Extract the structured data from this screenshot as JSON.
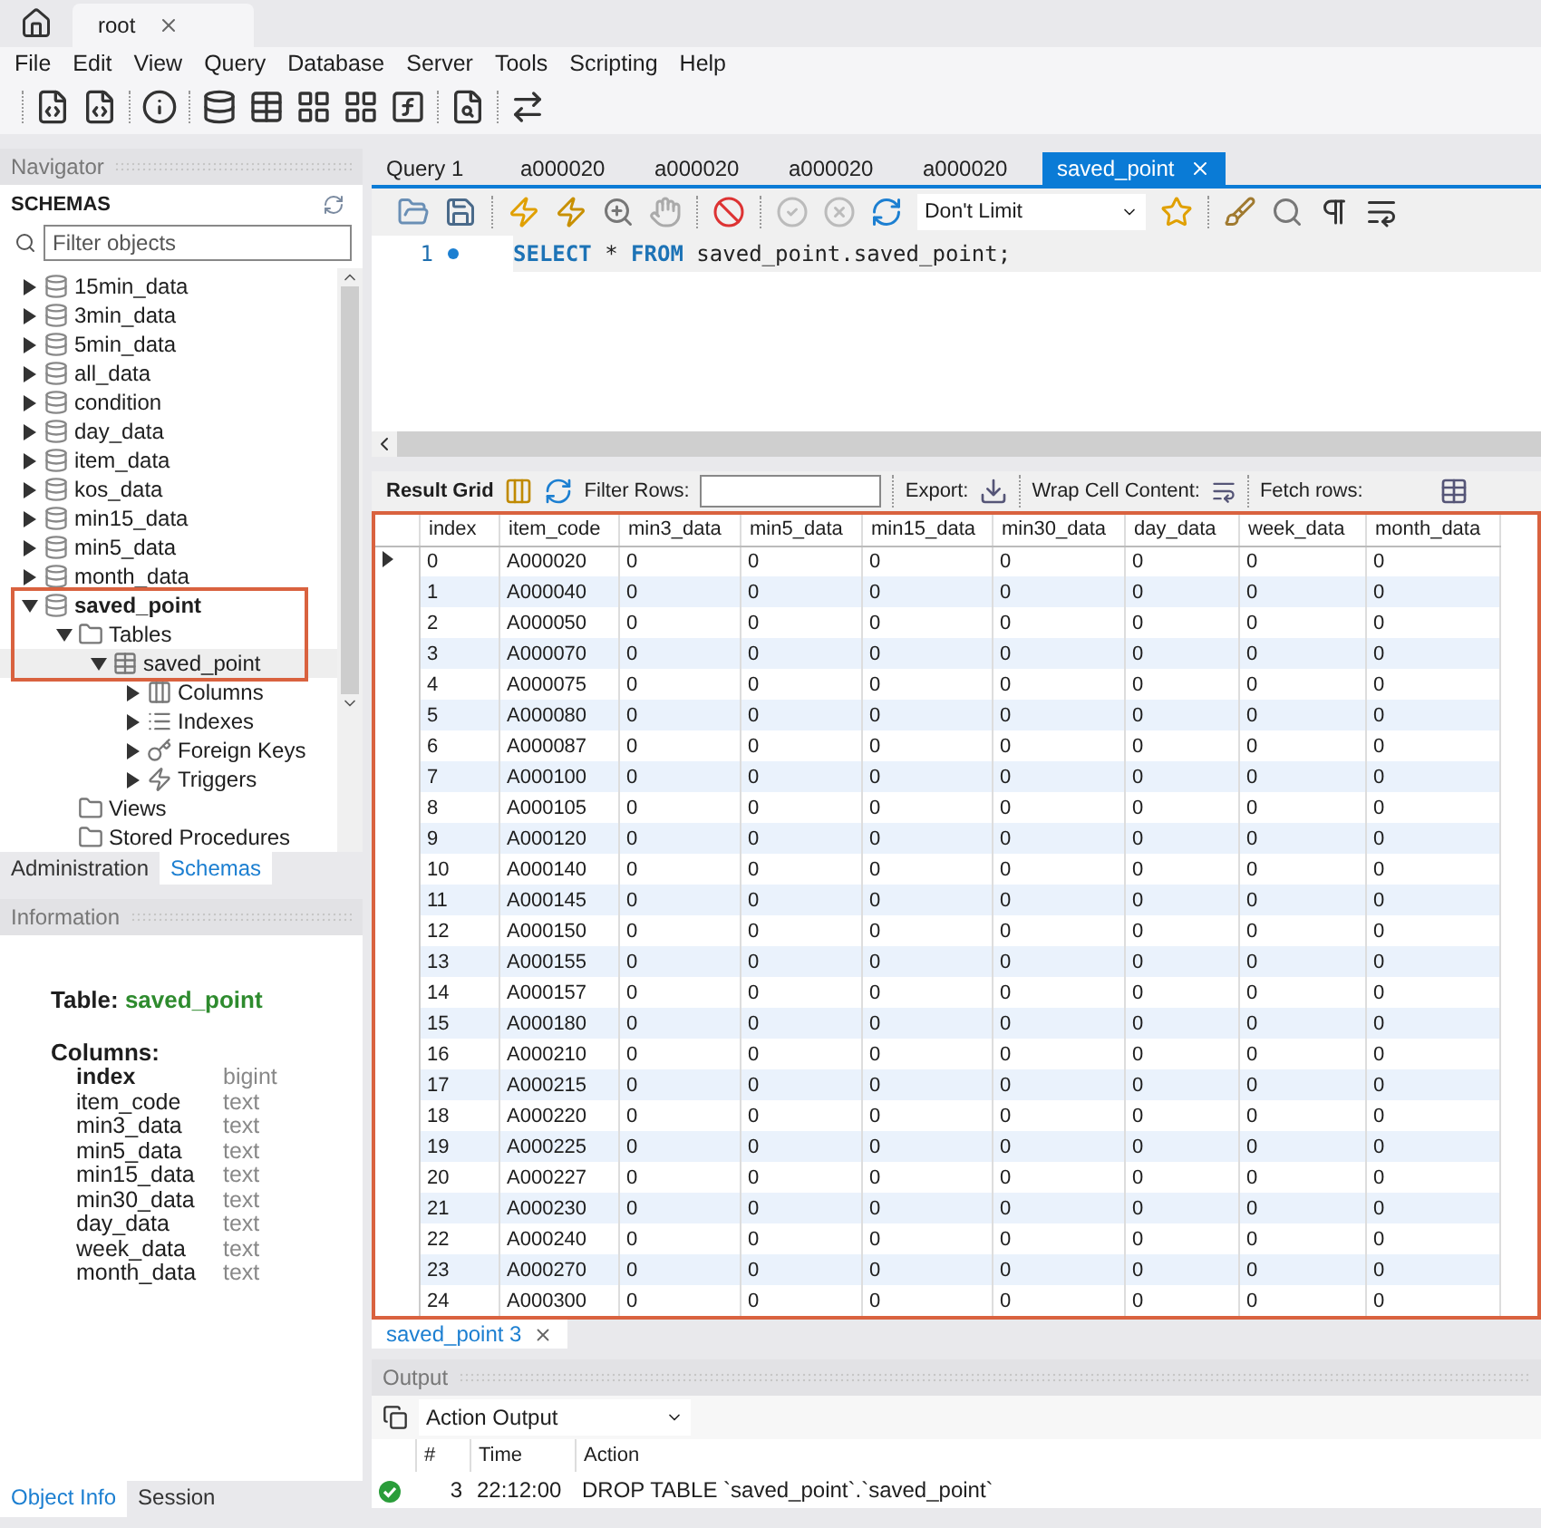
{
  "app_tabs": [
    {
      "label": "root",
      "selected": true
    }
  ],
  "menu": [
    "File",
    "Edit",
    "View",
    "Query",
    "Database",
    "Server",
    "Tools",
    "Scripting",
    "Help"
  ],
  "navigator": {
    "title": "Navigator",
    "schemas_title": "SCHEMAS",
    "filter_placeholder": "Filter objects",
    "tree": [
      {
        "label": "15min_data",
        "kind": "schema",
        "expanded": false
      },
      {
        "label": "3min_data",
        "kind": "schema",
        "expanded": false
      },
      {
        "label": "5min_data",
        "kind": "schema",
        "expanded": false
      },
      {
        "label": "all_data",
        "kind": "schema",
        "expanded": false
      },
      {
        "label": "condition",
        "kind": "schema",
        "expanded": false
      },
      {
        "label": "day_data",
        "kind": "schema",
        "expanded": false
      },
      {
        "label": "item_data",
        "kind": "schema",
        "expanded": false
      },
      {
        "label": "kos_data",
        "kind": "schema",
        "expanded": false
      },
      {
        "label": "min15_data",
        "kind": "schema",
        "expanded": false
      },
      {
        "label": "min5_data",
        "kind": "schema",
        "expanded": false
      },
      {
        "label": "month_data",
        "kind": "schema",
        "expanded": false
      },
      {
        "label": "saved_point",
        "kind": "schema",
        "expanded": true,
        "default": true,
        "outlined": true,
        "children": [
          {
            "label": "Tables",
            "kind": "folder",
            "expanded": true,
            "outlined": true,
            "children": [
              {
                "label": "saved_point",
                "kind": "table",
                "expanded": true,
                "selected": true,
                "outlined": true,
                "children": [
                  {
                    "label": "Columns",
                    "kind": "columns",
                    "expanded": false
                  },
                  {
                    "label": "Indexes",
                    "kind": "indexes",
                    "expanded": false
                  },
                  {
                    "label": "Foreign Keys",
                    "kind": "foreign_keys",
                    "expanded": false
                  },
                  {
                    "label": "Triggers",
                    "kind": "triggers",
                    "expanded": false
                  }
                ]
              }
            ]
          },
          {
            "label": "Views",
            "kind": "folder"
          },
          {
            "label": "Stored Procedures",
            "kind": "folder"
          }
        ]
      }
    ],
    "tabs": [
      {
        "label": "Administration",
        "selected": false
      },
      {
        "label": "Schemas",
        "selected": true
      }
    ]
  },
  "information": {
    "title": "Information",
    "table_label": "Table:",
    "table_name": "saved_point",
    "columns_label": "Columns:",
    "columns": [
      {
        "name": "index",
        "type": "bigint",
        "key": true
      },
      {
        "name": "item_code",
        "type": "text"
      },
      {
        "name": "min3_data",
        "type": "text"
      },
      {
        "name": "min5_data",
        "type": "text"
      },
      {
        "name": "min15_data",
        "type": "text"
      },
      {
        "name": "min30_data",
        "type": "text"
      },
      {
        "name": "day_data",
        "type": "text"
      },
      {
        "name": "week_data",
        "type": "text"
      },
      {
        "name": "month_data",
        "type": "text"
      }
    ],
    "tabs": [
      {
        "label": "Object Info",
        "selected": true
      },
      {
        "label": "Session",
        "selected": false
      }
    ]
  },
  "query_tabs": [
    {
      "label": "Query 1",
      "selected": false
    },
    {
      "label": "a000020",
      "selected": false
    },
    {
      "label": "a000020",
      "selected": false
    },
    {
      "label": "a000020",
      "selected": false
    },
    {
      "label": "a000020",
      "selected": false
    },
    {
      "label": "saved_point",
      "selected": true
    }
  ],
  "limit": "Don't Limit",
  "editor": {
    "lines": [
      {
        "number": "1",
        "tokens": [
          {
            "kind": "keyword",
            "text": "SELECT"
          },
          {
            "kind": "plain",
            "text": " * "
          },
          {
            "kind": "keyword",
            "text": "FROM"
          },
          {
            "kind": "plain",
            "text": " saved_point.saved_point;"
          }
        ]
      }
    ]
  },
  "result_toolbar": {
    "grid_label": "Result Grid",
    "filter_label": "Filter Rows:",
    "export_label": "Export:",
    "wrap_label": "Wrap Cell Content:",
    "fetch_label": "Fetch rows:"
  },
  "grid": {
    "outlined": true,
    "columns": [
      "index",
      "item_code",
      "min3_data",
      "min5_data",
      "min15_data",
      "min30_data",
      "day_data",
      "week_data",
      "month_data"
    ],
    "rows": [
      {
        "current": true,
        "cells": [
          "0",
          "A000020",
          "0",
          "0",
          "0",
          "0",
          "0",
          "0",
          "0"
        ]
      },
      {
        "cells": [
          "1",
          "A000040",
          "0",
          "0",
          "0",
          "0",
          "0",
          "0",
          "0"
        ]
      },
      {
        "cells": [
          "2",
          "A000050",
          "0",
          "0",
          "0",
          "0",
          "0",
          "0",
          "0"
        ]
      },
      {
        "cells": [
          "3",
          "A000070",
          "0",
          "0",
          "0",
          "0",
          "0",
          "0",
          "0"
        ]
      },
      {
        "cells": [
          "4",
          "A000075",
          "0",
          "0",
          "0",
          "0",
          "0",
          "0",
          "0"
        ]
      },
      {
        "cells": [
          "5",
          "A000080",
          "0",
          "0",
          "0",
          "0",
          "0",
          "0",
          "0"
        ]
      },
      {
        "cells": [
          "6",
          "A000087",
          "0",
          "0",
          "0",
          "0",
          "0",
          "0",
          "0"
        ]
      },
      {
        "cells": [
          "7",
          "A000100",
          "0",
          "0",
          "0",
          "0",
          "0",
          "0",
          "0"
        ]
      },
      {
        "cells": [
          "8",
          "A000105",
          "0",
          "0",
          "0",
          "0",
          "0",
          "0",
          "0"
        ]
      },
      {
        "cells": [
          "9",
          "A000120",
          "0",
          "0",
          "0",
          "0",
          "0",
          "0",
          "0"
        ]
      },
      {
        "cells": [
          "10",
          "A000140",
          "0",
          "0",
          "0",
          "0",
          "0",
          "0",
          "0"
        ]
      },
      {
        "cells": [
          "11",
          "A000145",
          "0",
          "0",
          "0",
          "0",
          "0",
          "0",
          "0"
        ]
      },
      {
        "cells": [
          "12",
          "A000150",
          "0",
          "0",
          "0",
          "0",
          "0",
          "0",
          "0"
        ]
      },
      {
        "cells": [
          "13",
          "A000155",
          "0",
          "0",
          "0",
          "0",
          "0",
          "0",
          "0"
        ]
      },
      {
        "cells": [
          "14",
          "A000157",
          "0",
          "0",
          "0",
          "0",
          "0",
          "0",
          "0"
        ]
      },
      {
        "cells": [
          "15",
          "A000180",
          "0",
          "0",
          "0",
          "0",
          "0",
          "0",
          "0"
        ]
      },
      {
        "cells": [
          "16",
          "A000210",
          "0",
          "0",
          "0",
          "0",
          "0",
          "0",
          "0"
        ]
      },
      {
        "cells": [
          "17",
          "A000215",
          "0",
          "0",
          "0",
          "0",
          "0",
          "0",
          "0"
        ]
      },
      {
        "cells": [
          "18",
          "A000220",
          "0",
          "0",
          "0",
          "0",
          "0",
          "0",
          "0"
        ]
      },
      {
        "cells": [
          "19",
          "A000225",
          "0",
          "0",
          "0",
          "0",
          "0",
          "0",
          "0"
        ]
      },
      {
        "cells": [
          "20",
          "A000227",
          "0",
          "0",
          "0",
          "0",
          "0",
          "0",
          "0"
        ]
      },
      {
        "cells": [
          "21",
          "A000230",
          "0",
          "0",
          "0",
          "0",
          "0",
          "0",
          "0"
        ]
      },
      {
        "cells": [
          "22",
          "A000240",
          "0",
          "0",
          "0",
          "0",
          "0",
          "0",
          "0"
        ]
      },
      {
        "cells": [
          "23",
          "A000270",
          "0",
          "0",
          "0",
          "0",
          "0",
          "0",
          "0"
        ]
      },
      {
        "cells": [
          "24",
          "A000300",
          "0",
          "0",
          "0",
          "0",
          "0",
          "0",
          "0"
        ]
      }
    ]
  },
  "result_tabs": [
    {
      "label": "saved_point 3",
      "selected": true
    }
  ],
  "output": {
    "title": "Output",
    "selector": "Action Output",
    "columns": [
      "#",
      "Time",
      "Action"
    ],
    "rows": [
      {
        "succeeded": true,
        "number": "3",
        "time": "22:12:00",
        "action": "DROP TABLE `saved_point`.`saved_point`"
      }
    ]
  }
}
